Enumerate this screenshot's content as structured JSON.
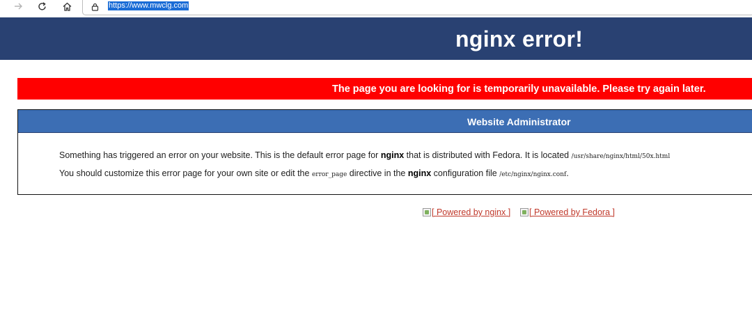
{
  "browser": {
    "url": "https://www.mwclg.com"
  },
  "page": {
    "title": "nginx error!",
    "alert": "The page you are looking for is temporarily unavailable. Please try again later.",
    "box_heading": "Website Administrator",
    "para1": {
      "prefix": "Something has triggered an error on your website. This is the default error page for ",
      "bold": "nginx",
      "middle": " that is distributed with Fedora. It is located ",
      "path": "/usr/share/nginx/html/50x.html"
    },
    "para2": {
      "prefix": "You should customize this error page for your own site or edit the ",
      "directive": "error_page",
      "middle": " directive in the ",
      "bold": "nginx",
      "suffix": " configuration file ",
      "path": "/etc/nginx/nginx.conf",
      "end": "."
    },
    "links": [
      {
        "label": "[ Powered by nginx ]",
        "img_alt": "nginx"
      },
      {
        "label": "[ Powered by Fedora ]",
        "img_alt": "Fedora"
      }
    ]
  },
  "colors": {
    "header_bg": "#294172",
    "alert_bg": "#ff0000",
    "box_head_bg": "#3c6eb4",
    "link": "#c0392b"
  }
}
